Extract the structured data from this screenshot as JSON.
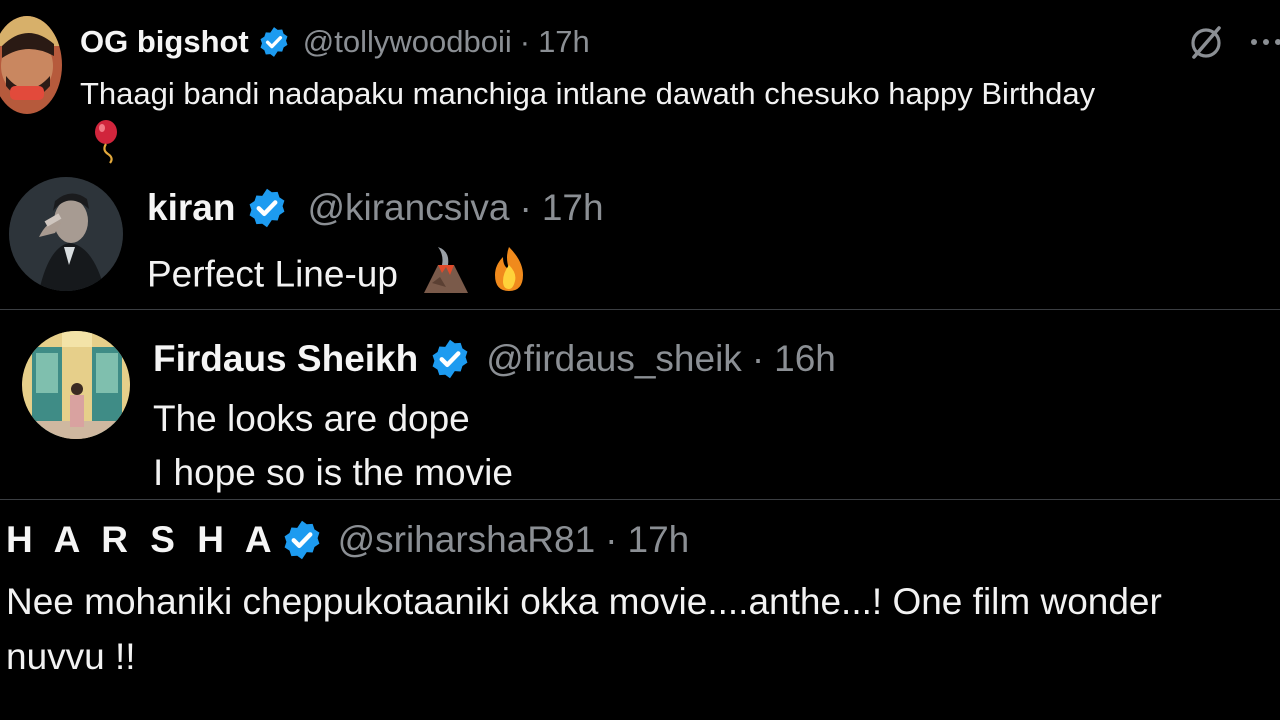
{
  "tweets": [
    {
      "name": "OG bigshot",
      "handle": "@tollywoodboii",
      "separator": "·",
      "time": "17h",
      "lines": [
        "Thaagi bandi nadapaku manchiga intlane dawath chesuko happy Birthday"
      ],
      "emoji": "balloon-icon",
      "actions": [
        "grok-icon",
        "more-icon"
      ]
    },
    {
      "name": "kiran",
      "handle": "@kirancsiva",
      "separator": "·",
      "time": "17h",
      "lines": [
        "Perfect Line-up"
      ],
      "emojis": [
        "volcano-icon",
        "fire-icon"
      ]
    },
    {
      "name": "Firdaus Sheikh",
      "handle": "@firdaus_sheik",
      "separator": "·",
      "time": "16h",
      "lines": [
        "The looks are dope",
        "I hope so is the movie"
      ]
    },
    {
      "name": "H A R S H A",
      "handle": "@sriharshaR81",
      "separator": "·",
      "time": "17h",
      "lines": [
        "Nee mohaniki cheppukotaaniki okka movie....anthe...! One film wonder",
        "nuvvu !!"
      ]
    }
  ],
  "colors": {
    "background": "#000000",
    "verified": "#1d9bf0",
    "muted": "#8b8f94",
    "divider": "#3b3e42"
  }
}
